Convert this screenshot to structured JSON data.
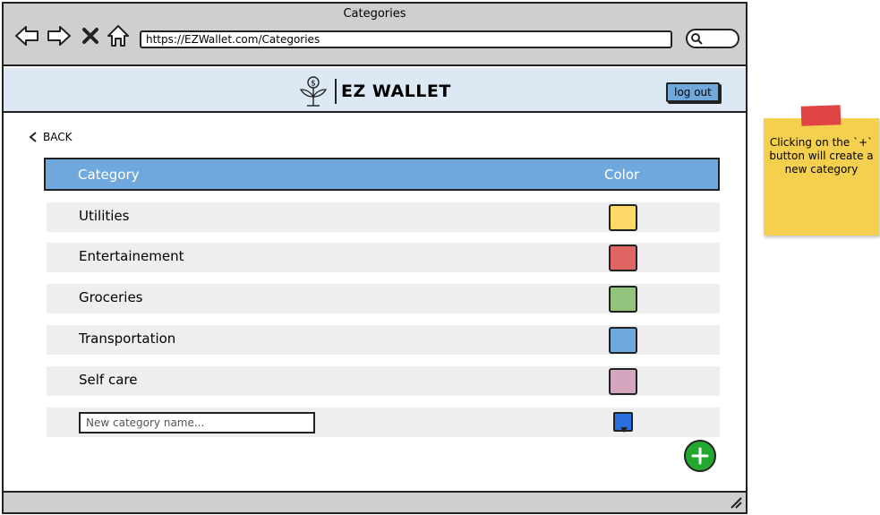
{
  "window": {
    "title": "Categories"
  },
  "browser": {
    "url": "https://EZWallet.com/Categories"
  },
  "header": {
    "brand": "EZ WALLET",
    "logout_label": "log out"
  },
  "nav": {
    "back_label": "BACK"
  },
  "table": {
    "columns": {
      "category": "Category",
      "color": "Color"
    },
    "rows": [
      {
        "name": "Utilities",
        "color": "#ffd966"
      },
      {
        "name": "Entertainement",
        "color": "#e06666"
      },
      {
        "name": "Groceries",
        "color": "#93c47d"
      },
      {
        "name": "Transportation",
        "color": "#6fa8dc"
      },
      {
        "name": "Self care",
        "color": "#d5a6bd"
      }
    ],
    "new_row": {
      "placeholder": "New category name...",
      "color": "#2b6fde"
    }
  },
  "note": {
    "text": "Clicking on the `+` button will create a new category"
  },
  "colors": {
    "header_blue": "#6fa8dc",
    "add_green": "#22a82e",
    "sticky_yellow": "#f5d04f",
    "app_header_bg": "#dde8f5"
  }
}
